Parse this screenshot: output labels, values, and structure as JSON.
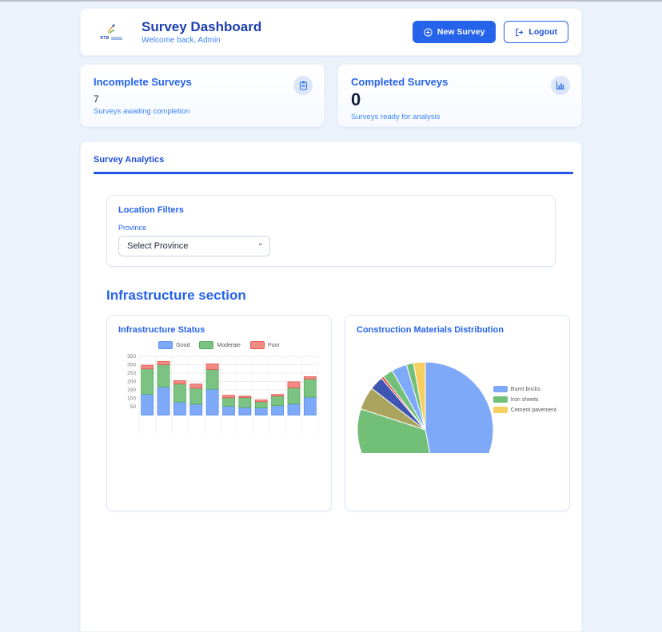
{
  "header": {
    "logo_text": "RTB",
    "title": "Survey Dashboard",
    "subtitle": "Welcome back, Admin",
    "new_survey_label": "New Survey",
    "logout_label": "Logout"
  },
  "stats": [
    {
      "title": "Incomplete Surveys",
      "value": "7",
      "caption": "Surveys awaiting completion",
      "icon": "clipboard-icon"
    },
    {
      "title": "Completed Surveys",
      "value": "0",
      "caption": "Surveys ready for analysis",
      "icon": "bar-chart-icon"
    }
  ],
  "analytics": {
    "tab_label": "Survey Analytics",
    "filters": {
      "title": "Location Filters",
      "province_label": "Province",
      "province_placeholder": "Select Province"
    },
    "section_title": "Infrastructure section"
  },
  "colors": {
    "accent_blue": "#2563eb",
    "dark_blue_title": "#1e3fae",
    "link_blue": "#3b82f6",
    "page_bg": "#ebf2fb",
    "good_fill": "#7ea8f8",
    "moderate_fill": "#7cc383",
    "poor_fill": "#f28b84"
  },
  "chart_data": [
    {
      "type": "bar",
      "title": "Infrastructure Status",
      "stacked": true,
      "categories": [
        "",
        "",
        "",
        "",
        "",
        "",
        "",
        "",
        "",
        "",
        ""
      ],
      "series": [
        {
          "name": "Good",
          "color": "#7ea8f8",
          "border": "#5b8def",
          "values": [
            125,
            168,
            78,
            65,
            155,
            53,
            46,
            43,
            57,
            67,
            107
          ]
        },
        {
          "name": "Moderate",
          "color": "#7cc383",
          "border": "#4caf50",
          "values": [
            150,
            132,
            107,
            95,
            117,
            50,
            59,
            37,
            56,
            96,
            108
          ]
        },
        {
          "name": "Poor",
          "color": "#f28b84",
          "border": "#e4574e",
          "values": [
            22,
            20,
            20,
            25,
            33,
            15,
            8,
            10,
            10,
            35,
            14
          ]
        }
      ],
      "xlabel": "",
      "ylabel": "",
      "ylim": [
        0,
        350
      ],
      "ytick_step": 50,
      "grid": true,
      "legend_position": "top"
    },
    {
      "type": "pie",
      "title": "Construction Materials Distribution",
      "legend_position": "right",
      "legend": [
        {
          "label": "Burnt bricks",
          "color": "#7ea8f8"
        },
        {
          "label": "Iron sheets",
          "color": "#72bf77"
        },
        {
          "label": "Cement pavement",
          "color": "#f7cf5e"
        }
      ],
      "slices": [
        {
          "label": "Burnt bricks",
          "color": "#7ea8f8",
          "percent": 47
        },
        {
          "label": "Iron sheets",
          "color": "#72bf77",
          "percent": 33
        },
        {
          "label": "",
          "color": "#a9a35e",
          "percent": 5.5
        },
        {
          "label": "",
          "color": "#4054b2",
          "percent": 3.3
        },
        {
          "label": "",
          "color": "#d93f36",
          "percent": 0.6
        },
        {
          "label": "",
          "color": "#72bf77",
          "percent": 2.5
        },
        {
          "label": "",
          "color": "#7ea8f8",
          "percent": 3.6
        },
        {
          "label": "",
          "color": "#72bf77",
          "percent": 1.7
        },
        {
          "label": "Cement pavement",
          "color": "#f7cf5e",
          "percent": 2.8
        }
      ]
    }
  ]
}
